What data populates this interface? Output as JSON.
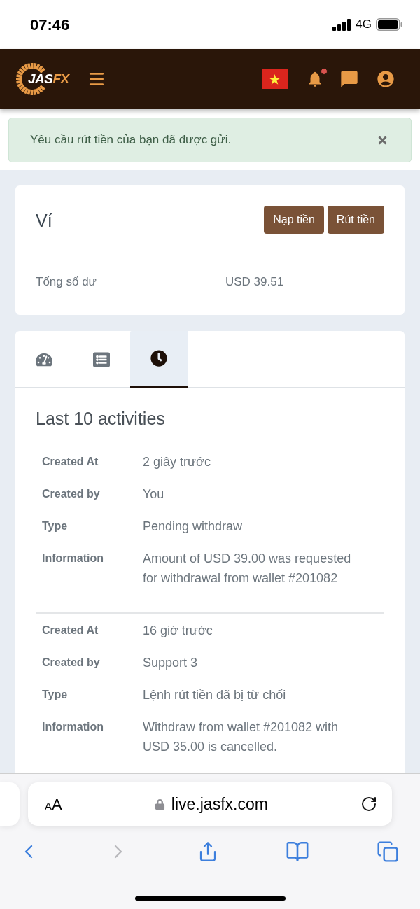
{
  "status_bar": {
    "time": "07:46",
    "network": "4G"
  },
  "header": {
    "logo": {
      "text": "JAS",
      "accent": "FX"
    },
    "notifications_unread": true
  },
  "alert": {
    "message": "Yêu cầu rút tiền của bạn đã được gửi.",
    "dismissible": true
  },
  "wallet": {
    "title": "Ví",
    "buttons": [
      "Nạp tiền",
      "Rút tiền"
    ],
    "balance_label": "Tổng số dư",
    "balance_value": "USD 39.51"
  },
  "tabs": [
    {
      "kind": "dashboard",
      "selected": false
    },
    {
      "kind": "list",
      "selected": false
    },
    {
      "kind": "history",
      "selected": true
    }
  ],
  "activities": {
    "title": "Last 10 activities",
    "entries": [
      {
        "fields": [
          {
            "label": "Created At",
            "value": "2 giây trước"
          },
          {
            "label": "Created by",
            "value": "You"
          },
          {
            "label": "Type",
            "value": "Pending withdraw"
          },
          {
            "label": "Information",
            "value": "Amount of USD 39.00 was requested for withdrawal from wallet #201082"
          }
        ]
      },
      {
        "fields": [
          {
            "label": "Created At",
            "value": "16 giờ trước"
          },
          {
            "label": "Created by",
            "value": "Support 3"
          },
          {
            "label": "Type",
            "value": "Lệnh rút tiền đã bị từ chối"
          },
          {
            "label": "Information",
            "value": "Withdraw from wallet #201082 with USD 35.00 is cancelled."
          }
        ]
      }
    ]
  },
  "browser": {
    "text_size": "AA",
    "url": "live.jasfx.com",
    "secure": true,
    "nav": [
      {
        "kind": "back",
        "disabled": false
      },
      {
        "kind": "forward",
        "disabled": true
      },
      {
        "kind": "share",
        "disabled": false
      },
      {
        "kind": "bookmarks",
        "disabled": false
      },
      {
        "kind": "tabs",
        "disabled": false
      }
    ]
  }
}
